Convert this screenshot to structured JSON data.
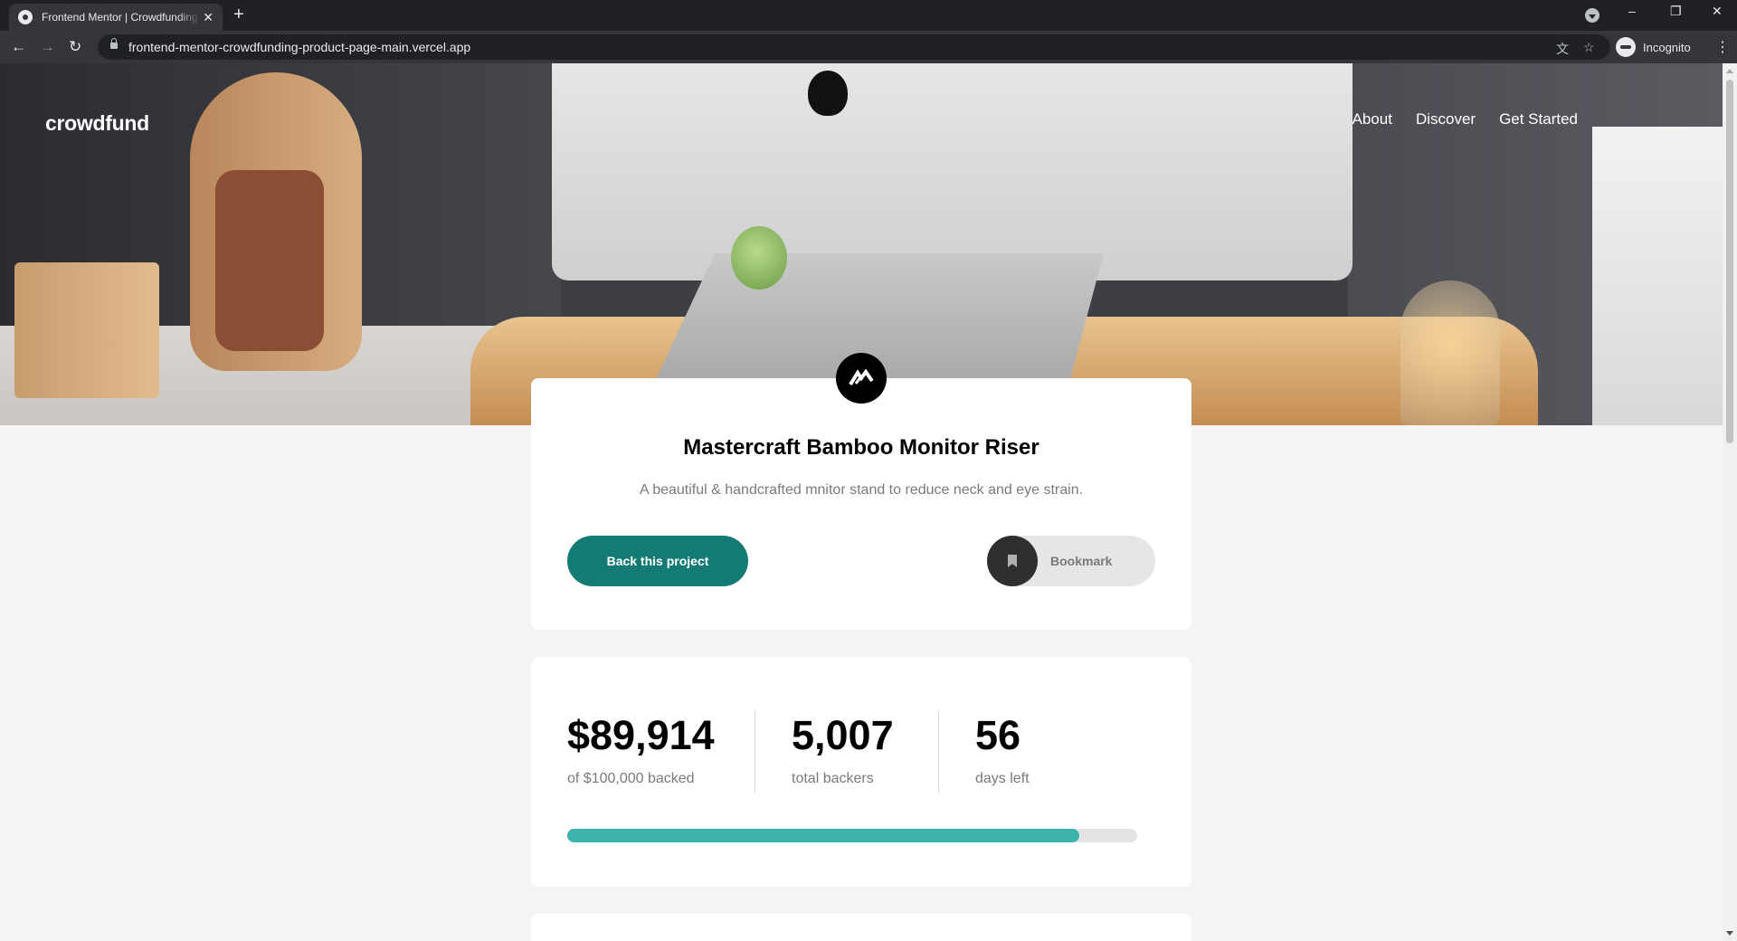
{
  "browser": {
    "tab_title": "Frontend Mentor | Crowdfunding product page",
    "new_tab": "+",
    "close_tab": "✕",
    "url": "frontend-mentor-crowdfunding-product-page-main.vercel.app",
    "profile_label": "Incognito"
  },
  "site": {
    "logo": "crowdfund",
    "nav": [
      "About",
      "Discover",
      "Get Started"
    ]
  },
  "product": {
    "title": "Mastercraft Bamboo Monitor Riser",
    "description": "A beautiful & handcrafted mnitor stand to reduce neck and eye strain.",
    "back_button": "Back this project",
    "bookmark_button": "Bookmark"
  },
  "stats": {
    "backed_amount": "$89,914",
    "backed_label": "of $100,000 backed",
    "backers_count": "5,007",
    "backers_label": "total backers",
    "days_left": "56",
    "days_label": "days left",
    "progress_percent": 89.914
  },
  "colors": {
    "primary_dark_cyan": "#147b74",
    "primary_cyan": "#3cb3ab",
    "text_gray": "#7a7a7a"
  },
  "icons": {
    "tab_favicon": "frontend-mentor-icon",
    "product_logo": "mastercraft-logo-icon",
    "bookmark": "bookmark-icon"
  }
}
